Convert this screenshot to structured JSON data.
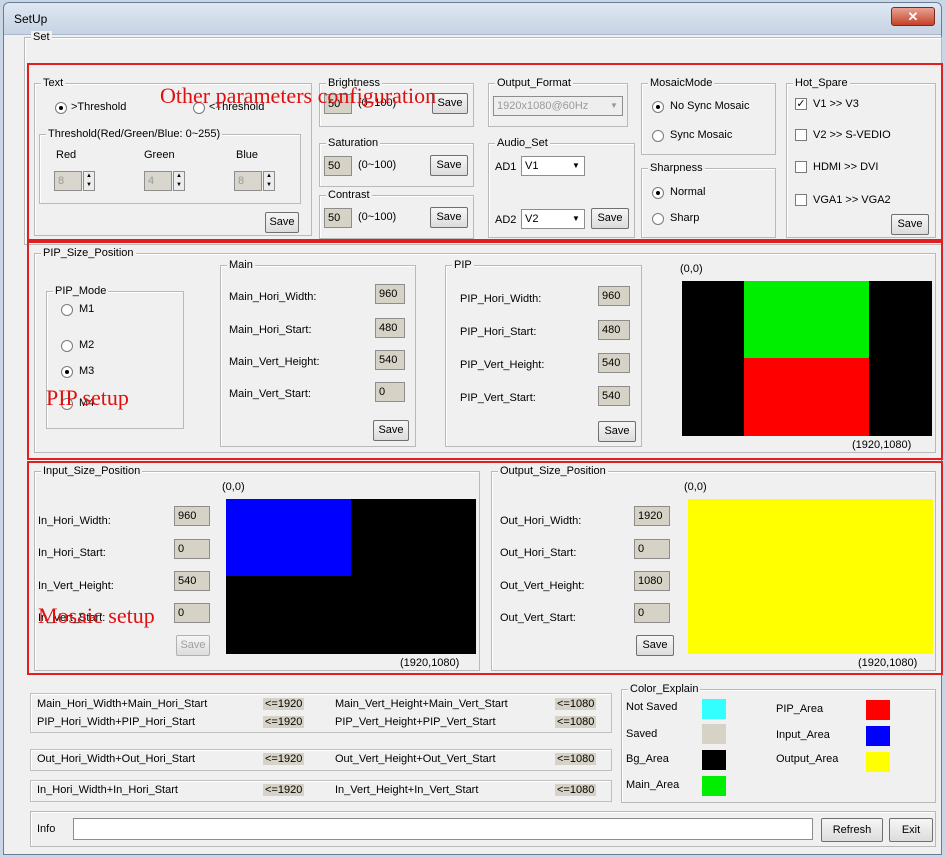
{
  "window": {
    "title": "SetUp",
    "close": "✕"
  },
  "annotations": {
    "other": "Other parameters configuration",
    "pip": "PIP setup",
    "mosaic": "Mosaic setup"
  },
  "set": {
    "label": "Set"
  },
  "text_group": {
    "label": "Text",
    "opt1": ">Threshold",
    "opt2": "<Threshold",
    "threshold_label": "Threshold(Red/Green/Blue:  0~255)",
    "red": "Red",
    "green": "Green",
    "blue": "Blue",
    "red_val": "8",
    "green_val": "4",
    "blue_val": "8",
    "save": "Save"
  },
  "brightness": {
    "label": "Brightness",
    "value": "50",
    "range": "(0~100)",
    "save": "Save"
  },
  "saturation": {
    "label": "Saturation",
    "value": "50",
    "range": "(0~100)",
    "save": "Save"
  },
  "contrast": {
    "label": "Contrast",
    "value": "50",
    "range": "(0~100)",
    "save": "Save"
  },
  "output_format": {
    "label": "Output_Format",
    "value": "1920x1080@60Hz"
  },
  "audio": {
    "label": "Audio_Set",
    "ad1": "AD1",
    "ad1_val": "V1",
    "ad2": "AD2",
    "ad2_val": "V2",
    "save": "Save"
  },
  "mosaic_mode": {
    "label": "MosaicMode",
    "opt1": "No Sync Mosaic",
    "opt2": "Sync Mosaic"
  },
  "sharpness": {
    "label": "Sharpness",
    "opt1": "Normal",
    "opt2": "Sharp"
  },
  "hot_spare": {
    "label": "Hot_Spare",
    "items": [
      "V1  >>  V3",
      "V2  >>  S-VEDIO",
      "HDMI  >>  DVI",
      "VGA1  >>  VGA2"
    ],
    "save": "Save"
  },
  "pip_size": {
    "label": "PIP_Size_Position",
    "mode_label": "PIP_Mode",
    "modes": [
      "M1",
      "M2",
      "M3",
      "M4"
    ],
    "main": {
      "label": "Main",
      "fields": [
        "Main_Hori_Width:",
        "Main_Hori_Start:",
        "Main_Vert_Height:",
        "Main_Vert_Start:"
      ],
      "values": [
        "960",
        "480",
        "540",
        "0"
      ],
      "save": "Save"
    },
    "pip": {
      "label": "PIP",
      "fields": [
        "PIP_Hori_Width:",
        "PIP_Hori_Start:",
        "PIP_Vert_Height:",
        "PIP_Vert_Start:"
      ],
      "values": [
        "960",
        "480",
        "540",
        "540"
      ],
      "save": "Save"
    },
    "origin": "(0,0)",
    "corner": "(1920,1080)"
  },
  "input_size": {
    "label": "Input_Size_Position",
    "fields": [
      "In_Hori_Width:",
      "In_Hori_Start:",
      "In_Vert_Height:",
      "In_Vert_Start:"
    ],
    "values": [
      "960",
      "0",
      "540",
      "0"
    ],
    "save": "Save",
    "origin": "(0,0)",
    "corner": "(1920,1080)"
  },
  "output_size": {
    "label": "Output_Size_Position",
    "fields": [
      "Out_Hori_Width:",
      "Out_Hori_Start:",
      "Out_Vert_Height:",
      "Out_Vert_Start:"
    ],
    "values": [
      "1920",
      "0",
      "1080",
      "0"
    ],
    "save": "Save",
    "origin": "(0,0)",
    "corner": "(1920,1080)"
  },
  "constraints": {
    "r1a": "Main_Hori_Width+Main_Hori_Start",
    "r1b": "<=1920",
    "r1c": "Main_Vert_Height+Main_Vert_Start",
    "r1d": "<=1080",
    "r2a": "PIP_Hori_Width+PIP_Hori_Start",
    "r2b": "<=1920",
    "r2c": "PIP_Vert_Height+PIP_Vert_Start",
    "r2d": "<=1080",
    "r3a": "Out_Hori_Width+Out_Hori_Start",
    "r3b": "<=1920",
    "r3c": "Out_Vert_Height+Out_Vert_Start",
    "r3d": "<=1080",
    "r4a": "In_Hori_Width+In_Hori_Start",
    "r4b": "<=1920",
    "r4c": "In_Vert_Height+In_Vert_Start",
    "r4d": "<=1080"
  },
  "color_explain": {
    "label": "Color_Explain",
    "not_saved": "Not Saved",
    "saved": "Saved",
    "bg": "Bg_Area",
    "main": "Main_Area",
    "pip": "PIP_Area",
    "input": "Input_Area",
    "output": "Output_Area",
    "colors": {
      "not_saved": "#33ffff",
      "saved": "#d6d3c6",
      "bg": "#000000",
      "main": "#00ff00",
      "pip": "#ff0000",
      "input": "#0000ff",
      "output": "#ffff00"
    }
  },
  "info": {
    "label": "Info",
    "value": ""
  },
  "buttons": {
    "refresh": "Refresh",
    "exit": "Exit"
  }
}
